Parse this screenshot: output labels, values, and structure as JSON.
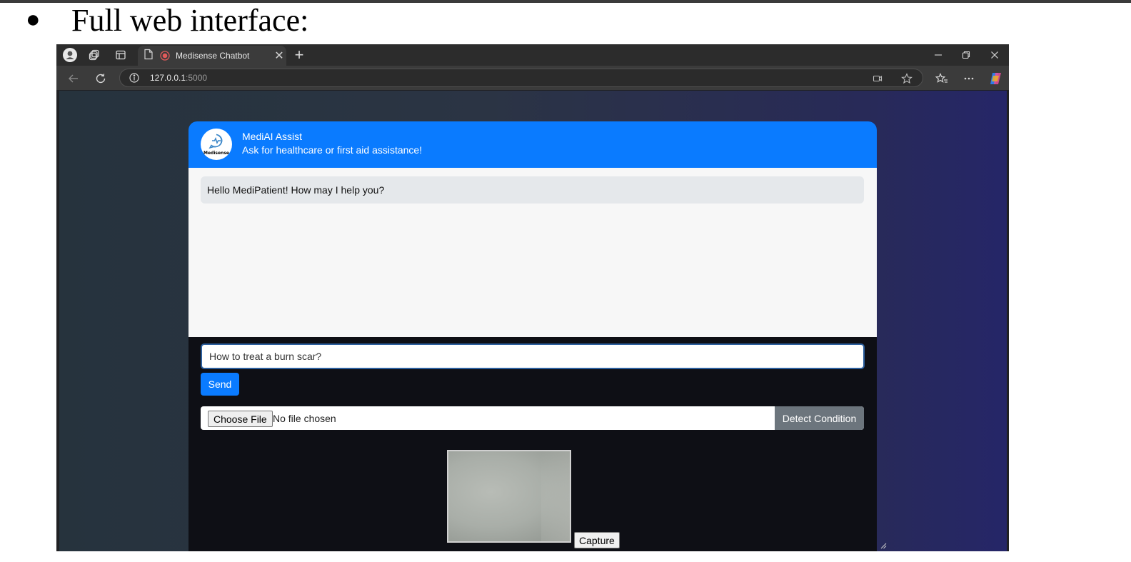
{
  "doc": {
    "bullet": "●",
    "heading": "Full web interface:"
  },
  "browser": {
    "tab_title": "Medisense Chatbot",
    "tab_close": "✕",
    "new_tab": "+",
    "url_host": "127.0.0.1",
    "url_port": ":5000",
    "icons": [
      "profile-icon",
      "workspaces-icon",
      "tab-actions-icon",
      "page-icon",
      "recording-icon",
      "minimize-icon",
      "restore-icon",
      "close-icon",
      "back-icon",
      "refresh-icon",
      "site-info-icon",
      "cast-icon",
      "favorite-star-icon",
      "favorites-icon",
      "more-icon",
      "copilot-icon"
    ]
  },
  "app": {
    "logo_text": "Medisense",
    "title": "MediAI Assist",
    "subtitle": "Ask for healthcare or first aid assistance!",
    "messages": [
      {
        "from": "bot",
        "text": "Hello MediPatient! How may I help you?"
      }
    ],
    "input": {
      "value": "How to treat a burn scar?"
    },
    "send_label": "Send",
    "file": {
      "choose_label": "Choose File",
      "status": "No file chosen",
      "detect_label": "Detect Condition"
    },
    "capture_label": "Capture"
  },
  "colors": {
    "header_blue": "#0a7bff",
    "detect_gray": "#6c757d",
    "bubble_gray": "#e5e8eb"
  }
}
